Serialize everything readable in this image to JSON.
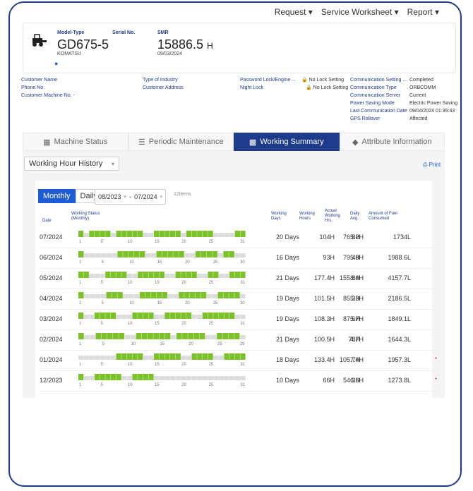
{
  "nav": {
    "request": "Request ▾",
    "service": "Service Worksheet ▾",
    "report": "Report ▾"
  },
  "machine": {
    "model_type_label": "Model-Type",
    "serial_label": "Serial No.",
    "smr_label": "SMR",
    "model": "GD675-5",
    "maker": "KOMATSU",
    "smr_value": "15886.5",
    "smr_unit": "H",
    "smr_date": "09/03/2024"
  },
  "info_left": [
    {
      "k": "Customer Name",
      "v": ""
    },
    {
      "k": "Phone No.",
      "v": ""
    },
    {
      "k": "Customer Machine No. -",
      "v": ""
    }
  ],
  "info_mid": [
    {
      "k": "Type of Industry",
      "v": ""
    },
    {
      "k": "Customer Address",
      "v": ""
    }
  ],
  "info_lock": [
    {
      "k": "Password Lock/Engine ...",
      "v": "No Lock Setting"
    },
    {
      "k": "Night Lock",
      "v": "No Lock Setting"
    }
  ],
  "info_right": [
    {
      "k": "Communication Setting ...",
      "v": "Completed"
    },
    {
      "k": "Communication Type",
      "v": "ORBCOMM"
    },
    {
      "k": "Communication Server",
      "v": "Current"
    },
    {
      "k": "Power Saving Mode",
      "v": "Electric Power Saving"
    },
    {
      "k": "Last Communication Date",
      "v": "09/04/2024 01:39:43"
    },
    {
      "k": "GPS Rollover",
      "v": "Affected"
    }
  ],
  "tabs": [
    "Machine Status",
    "Periodic Maintenance",
    "Working Summary",
    "Attribute Information"
  ],
  "history_select": "Working Hour History",
  "print": "Print",
  "mode": {
    "monthly": "Monthly",
    "daily": "Daily"
  },
  "range": {
    "from": "08/2023",
    "sep": "-",
    "to": "07/2024"
  },
  "items_count": "12items",
  "headers": {
    "date": "Date",
    "status": "Working Status (Monthly)",
    "days": "Working Days",
    "hours": "Working Hours",
    "actual": "Actual Working Hrs.",
    "avg": "Daily Avg.",
    "fuel": "Amount of Fuel Consumed"
  },
  "rows": [
    {
      "date": "07/2024",
      "days": "20 Days",
      "hours": "104H",
      "actual": "76.8H",
      "avg": "5.2H",
      "fuel": "1734L",
      "end": "31",
      "dash": "",
      "pattern": [
        1,
        0,
        1,
        1,
        1,
        1,
        0,
        1,
        1,
        1,
        1,
        1,
        0,
        0,
        1,
        1,
        1,
        1,
        1,
        0,
        1,
        1,
        1,
        1,
        1,
        0,
        0,
        0,
        0,
        1,
        1
      ]
    },
    {
      "date": "06/2024",
      "days": "16 Days",
      "hours": "93H",
      "actual": "79.4H",
      "avg": "5.8H",
      "fuel": "1988.6L",
      "end": "30",
      "dash": "",
      "pattern": [
        1,
        0,
        0,
        0,
        0,
        0,
        0,
        1,
        1,
        1,
        1,
        1,
        0,
        0,
        1,
        1,
        1,
        1,
        1,
        0,
        0,
        1,
        1,
        1,
        1,
        0,
        1,
        1,
        0,
        0
      ]
    },
    {
      "date": "05/2024",
      "days": "21 Days",
      "hours": "177.4H",
      "actual": "155.8H",
      "avg": "8.4H",
      "fuel": "4157.7L",
      "end": "31",
      "dash": "",
      "pattern": [
        1,
        1,
        0,
        0,
        0,
        1,
        1,
        1,
        1,
        0,
        0,
        1,
        1,
        1,
        1,
        1,
        0,
        0,
        1,
        1,
        1,
        1,
        0,
        0,
        1,
        1,
        0,
        0,
        1,
        1,
        1
      ]
    },
    {
      "date": "04/2024",
      "days": "19 Days",
      "hours": "101.5H",
      "actual": "85.3H",
      "avg": "5.3H",
      "fuel": "2186.5L",
      "end": "30",
      "dash": "",
      "pattern": [
        1,
        0,
        0,
        0,
        0,
        1,
        1,
        1,
        0,
        0,
        0,
        1,
        1,
        1,
        1,
        1,
        0,
        0,
        1,
        1,
        1,
        1,
        1,
        0,
        0,
        1,
        1,
        1,
        1,
        0
      ]
    },
    {
      "date": "03/2024",
      "days": "19 Days",
      "hours": "108.3H",
      "actual": "87.6H",
      "avg": "5.7H",
      "fuel": "1849.1L",
      "end": "31",
      "dash": "",
      "pattern": [
        1,
        0,
        0,
        1,
        1,
        1,
        1,
        0,
        0,
        0,
        1,
        1,
        1,
        1,
        0,
        0,
        1,
        1,
        1,
        1,
        1,
        0,
        0,
        1,
        1,
        1,
        1,
        1,
        1,
        0,
        0
      ]
    },
    {
      "date": "02/2024",
      "days": "21 Days",
      "hours": "100.5H",
      "actual": "78H",
      "avg": "4.7H",
      "fuel": "1644.3L",
      "end": "29",
      "dash": "",
      "pattern": [
        1,
        0,
        0,
        1,
        1,
        1,
        1,
        1,
        0,
        0,
        1,
        1,
        1,
        1,
        1,
        1,
        0,
        1,
        1,
        1,
        1,
        1,
        0,
        0,
        1,
        1,
        1,
        1,
        0
      ]
    },
    {
      "date": "01/2024",
      "days": "18 Days",
      "hours": "133.4H",
      "actual": "105.7H",
      "avg": "7.4H",
      "fuel": "1957.3L",
      "end": "31",
      "dash": "*",
      "pattern": [
        0,
        0,
        0,
        0,
        0,
        0,
        0,
        1,
        1,
        1,
        1,
        1,
        0,
        0,
        1,
        1,
        1,
        1,
        1,
        0,
        0,
        1,
        1,
        1,
        1,
        0,
        0,
        1,
        1,
        1,
        1
      ]
    },
    {
      "date": "12/2023",
      "days": "10 Days",
      "hours": "66H",
      "actual": "54.3H",
      "avg": "6.6H",
      "fuel": "1273.8L",
      "end": "31",
      "dash": "*",
      "pattern": [
        1,
        0,
        0,
        1,
        1,
        1,
        1,
        1,
        0,
        0,
        1,
        1,
        1,
        1,
        0,
        0,
        0,
        0,
        0,
        0,
        0,
        0,
        0,
        0,
        0,
        0,
        0,
        0,
        0,
        0,
        0
      ]
    }
  ],
  "colors": {
    "accent": "#1e3a8a",
    "bar_on": "#7cc12a",
    "bar_off": "#dcdcdc"
  }
}
